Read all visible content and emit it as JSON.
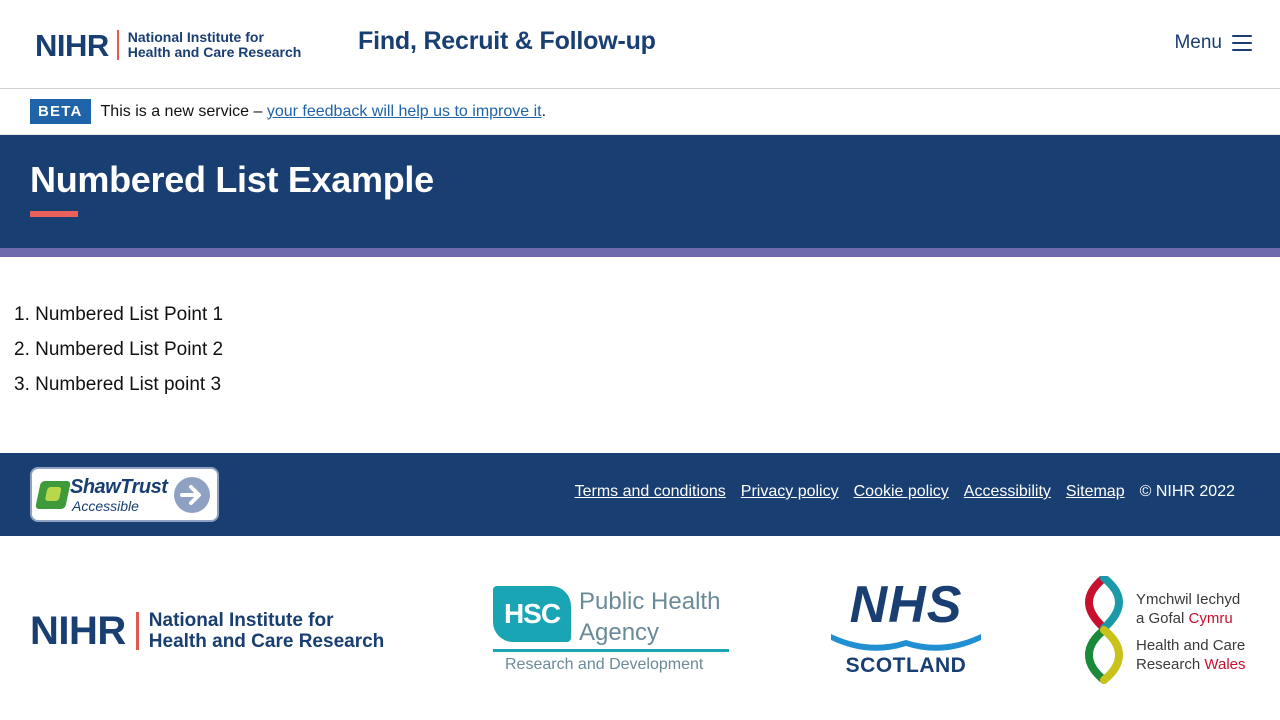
{
  "header": {
    "logo": {
      "letters": "NIHR",
      "line1": "National Institute for",
      "line2": "Health and Care Research"
    },
    "service_name": "Find, Recruit & Follow-up",
    "menu_label": "Menu"
  },
  "beta_banner": {
    "tag": "BETA",
    "text": "This is a new service –",
    "link_text": "your feedback will help us to improve it",
    "suffix": "."
  },
  "hero": {
    "title": "Numbered List Example"
  },
  "content": {
    "list": [
      "1. Numbered List Point 1",
      "2. Numbered List Point 2",
      "3. Numbered List point 3"
    ]
  },
  "footer": {
    "badge": {
      "title": "ShawTrust",
      "subtitle": "Accessible"
    },
    "links": [
      "Terms and conditions",
      "Privacy policy",
      "Cookie policy",
      "Accessibility",
      "Sitemap"
    ],
    "copyright": "© NIHR 2022"
  },
  "partners": {
    "nihr": {
      "letters": "NIHR",
      "line1": "National Institute for",
      "line2": "Health and Care Research"
    },
    "hsc": {
      "badge": "HSC",
      "name_line1": "Public Health",
      "name_line2": "Agency",
      "sub": "Research and Development"
    },
    "nhs": {
      "word": "NHS",
      "sub": "SCOTLAND"
    },
    "wales": {
      "line1": "Ymchwil Iechyd",
      "line2_prefix": "a Gofal",
      "line2_red": "Cymru",
      "line3": "Health and Care",
      "line4_prefix": "Research",
      "line4_red": "Wales"
    }
  },
  "colors": {
    "navy": "#193e72",
    "accent_red": "#e8615a",
    "stripe_purple": "#6e68ad",
    "link_blue": "#1f63a8",
    "hsc_teal": "#1aa5b5"
  }
}
